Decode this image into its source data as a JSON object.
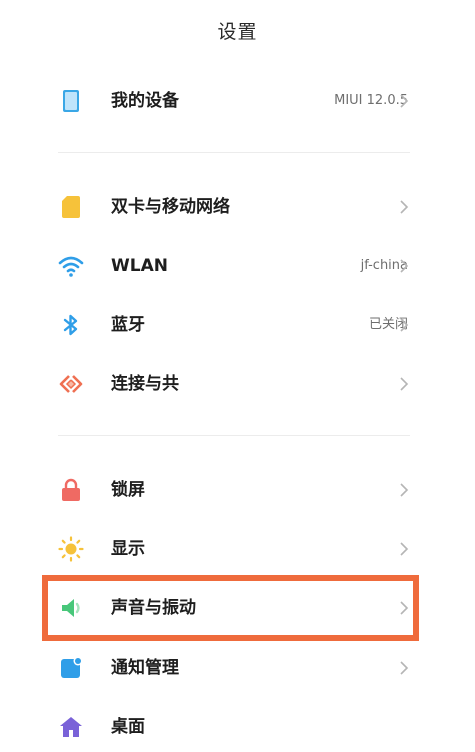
{
  "header": {
    "title": "设置"
  },
  "items": [
    {
      "label": "我的设备",
      "value": "MIUI 12.0.5",
      "icon": "device-icon"
    },
    {
      "label": "双卡与移动网络",
      "value": "",
      "icon": "sim-card-icon"
    },
    {
      "label": "WLAN",
      "value": "jf-china",
      "icon": "wifi-icon"
    },
    {
      "label": "蓝牙",
      "value": "已关闭",
      "icon": "bluetooth-icon"
    },
    {
      "label": "连接与共",
      "value": "",
      "icon": "connection-share-icon"
    },
    {
      "label": "锁屏",
      "value": "",
      "icon": "lock-icon"
    },
    {
      "label": "显示",
      "value": "",
      "icon": "sun-icon"
    },
    {
      "label": "声音与振动",
      "value": "",
      "icon": "speaker-icon"
    },
    {
      "label": "通知管理",
      "value": "",
      "icon": "notification-icon"
    },
    {
      "label": "桌面",
      "value": "",
      "icon": "home-icon"
    }
  ],
  "colors": {
    "highlight": "#ef6b3c",
    "device": "#3aa7e6",
    "sim": "#f6c23a",
    "wifi": "#2f9ee8",
    "bluetooth": "#2f9ee8",
    "connection": "#ef7052",
    "lock": "#ef6a63",
    "sun": "#f6c23a",
    "speaker": "#48c77a",
    "notification": "#2f9ee8",
    "home": "#7a62d8"
  }
}
